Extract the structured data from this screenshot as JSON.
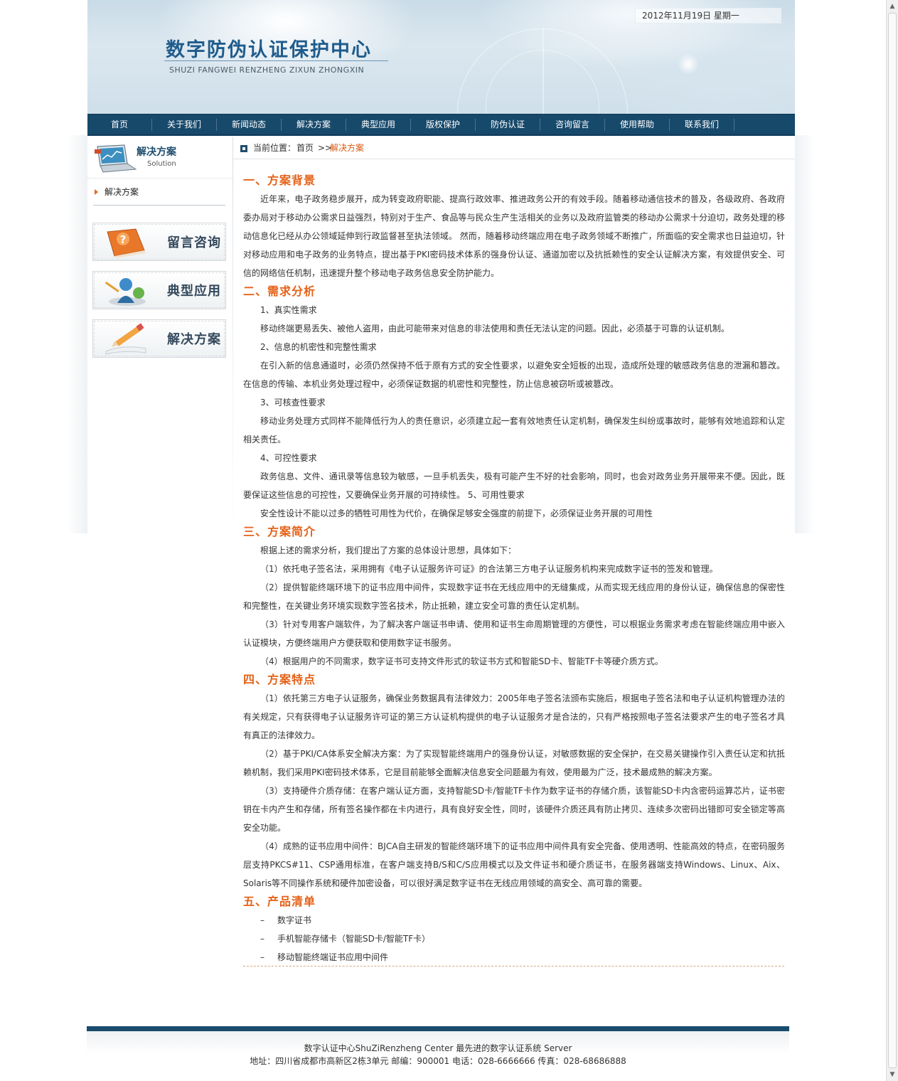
{
  "header": {
    "title": "数字防伪认证保护中心",
    "subtitle": "SHUZI FANGWEI RENZHENG  ZIXUN ZHONGXIN",
    "date": "2012年11月19日  星期一"
  },
  "nav": [
    "首页",
    "关于我们",
    "新闻动态",
    "解决方案",
    "典型应用",
    "版权保护",
    "防伪认证",
    "咨询留言",
    "使用帮助",
    "联系我们"
  ],
  "sidebar": {
    "title": "解决方案",
    "title_en": "Solution",
    "item": "解决方案",
    "promos": [
      "留言咨询",
      "典型应用",
      "解决方案"
    ]
  },
  "breadcrumb": {
    "label": "当前位置：",
    "home": "首页",
    "sep": ">>",
    "current": "解决方案"
  },
  "article": {
    "h1": "一、方案背景",
    "p1": "近年来，电子政务稳步展开，成为转变政府职能、提高行政效率、推进政务公开的有效手段。随着移动通信技术的普及，各级政府、各政府委办局对于移动办公需求日益强烈，特别对于生产、食品等与民众生产生活相关的业务以及政府监管类的移动办公需求十分迫切，政务处理的移动信息化已经从办公领域延伸到行政监督甚至执法领域。        然而，随着移动终端应用在电子政务领域不断推广，所面临的安全需求也日益迫切，针对移动应用和电子政务的业务特点，提出基于PKI密码技术体系的强身份认证、通道加密以及抗抵赖性的安全认证解决方案，有效提供安全、可信的网络信任机制，迅速提升整个移动电子政务信息安全防护能力。",
    "h2": "二、需求分析",
    "n1": "1、真实性需求",
    "p2": "移动终端更易丢失、被他人盗用，由此可能带来对信息的非法使用和责任无法认定的问题。因此，必须基于可靠的认证机制。",
    "n2": "2、信息的机密性和完整性需求",
    "p3": "在引入新的信息通道时，必须仍然保持不低于原有方式的安全性要求，以避免安全短板的出现，造成所处理的敏感政务信息的泄漏和篡改。在信息的传输、本机业务处理过程中，必须保证数据的机密性和完整性，防止信息被窃听或被篡改。",
    "n3": "3、可核查性要求",
    "p4": "移动业务处理方式同样不能降低行为人的责任意识，必须建立起一套有效地责任认定机制，确保发生纠纷或事故时，能够有效地追踪和认定相关责任。",
    "n4": "4、可控性要求",
    "p5": "政务信息、文件、通讯录等信息较为敏感，一旦手机丢失，极有可能产生不好的社会影响，同时，也会对政务业务开展带来不便。因此，既要保证这些信息的可控性，又要确保业务开展的可持续性。        5、可用性要求",
    "p6": "安全性设计不能以过多的牺牲可用性为代价，在确保足够安全强度的前提下，必须保证业务开展的可用性",
    "h3": "三、方案简介",
    "p7": "根据上述的需求分析，我们提出了方案的总体设计思想，具体如下：",
    "p8": "（1）依托电子签名法，采用拥有《电子认证服务许可证》的合法第三方电子认证服务机构来完成数字证书的签发和管理。",
    "p9": "（2）提供智能终端环境下的证书应用中间件，实现数字证书在无线应用中的无缝集成，从而实现无线应用的身份认证，确保信息的保密性和完整性，在关键业务环境实现数字签名技术，防止抵赖，建立安全可靠的责任认定机制。",
    "p10": "（3）针对专用客户端软件，为了解决客户端证书申请、使用和证书生命周期管理的方便性，可以根据业务需求考虑在智能终端应用中嵌入认证模块，方便终端用户方便获取和使用数字证书服务。",
    "p11": "（4）根据用户的不同需求，数字证书可支持文件形式的软证书方式和智能SD卡、智能TF卡等硬介质方式。",
    "h4": "四、方案特点",
    "p12": "（1）依托第三方电子认证服务，确保业务数据具有法律效力：2005年电子签名法颁布实施后，根据电子签名法和电子认证机构管理办法的有关规定，只有获得电子认证服务许可证的第三方认证机构提供的电子认证服务才是合法的，只有严格按照电子签名法要求产生的电子签名才具有真正的法律效力。",
    "p13": "（2）基于PKI/CA体系安全解决方案：为了实现智能终端用户的强身份认证，对敏感数据的安全保护，在交易关键操作引入责任认定和抗抵赖机制，我们采用PKI密码技术体系，它是目前能够全面解决信息安全问题最为有效，使用最为广泛，技术最成熟的解决方案。",
    "p14": "（3）支持硬件介质存储：在客户端认证方面，支持智能SD卡/智能TF卡作为数字证书的存储介质，该智能SD卡内含密码运算芯片，证书密钥在卡内产生和存储，所有签名操作都在卡内进行，具有良好安全性，同时，该硬件介质还具有防止拷贝、连续多次密码出错即可安全锁定等高安全功能。",
    "p15": "（4）成熟的证书应用中间件：BJCA自主研发的智能终端环境下的证书应用中间件具有安全完备、使用透明、性能高效的特点，在密码服务层支持PKCS#11、CSP通用标准，在客户端支持B/S和C/S应用模式以及文件证书和硬介质证书，在服务器端支持Windows、Linux、Aix、Solaris等不同操作系统和硬件加密设备，可以很好满足数字证书在无线应用领域的高安全、高可靠的需要。",
    "h5": "五、产品清单",
    "dash": "–",
    "items": [
      "数字证书",
      "手机智能存储卡（智能SD卡/智能TF卡）",
      "移动智能终端证书应用中间件"
    ]
  },
  "footer": {
    "line1": "数字认证中心ShuZiRenzheng Center 最先进的数字认证系统  Server",
    "line2": "地址：四川省成都市高新区2栋3单元  邮编：900001 电话：028-6666666 传真：028-68686888"
  }
}
